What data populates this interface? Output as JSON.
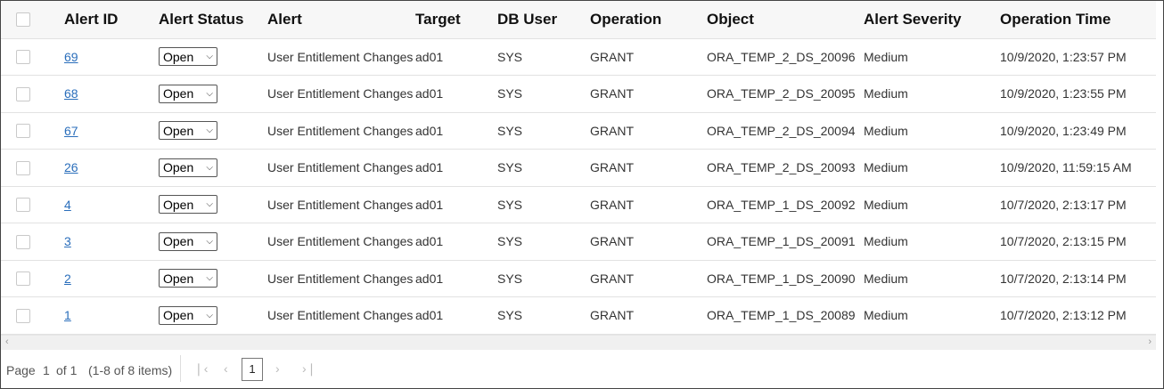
{
  "headers": {
    "alert_id": "Alert ID",
    "alert_status": "Alert Status",
    "alert": "Alert",
    "target": "Target",
    "db_user": "DB User",
    "operation": "Operation",
    "object": "Object",
    "alert_severity": "Alert Severity",
    "operation_time": "Operation Time"
  },
  "rows": [
    {
      "id": "69",
      "status": "Open",
      "alert": "User Entitlement Changes",
      "target": "ad01",
      "db_user": "SYS",
      "operation": "GRANT",
      "object": "ORA_TEMP_2_DS_20096",
      "severity": "Medium",
      "time": "10/9/2020, 1:23:57 PM"
    },
    {
      "id": "68",
      "status": "Open",
      "alert": "User Entitlement Changes",
      "target": "ad01",
      "db_user": "SYS",
      "operation": "GRANT",
      "object": "ORA_TEMP_2_DS_20095",
      "severity": "Medium",
      "time": "10/9/2020, 1:23:55 PM"
    },
    {
      "id": "67",
      "status": "Open",
      "alert": "User Entitlement Changes",
      "target": "ad01",
      "db_user": "SYS",
      "operation": "GRANT",
      "object": "ORA_TEMP_2_DS_20094",
      "severity": "Medium",
      "time": "10/9/2020, 1:23:49 PM"
    },
    {
      "id": "26",
      "status": "Open",
      "alert": "User Entitlement Changes",
      "target": "ad01",
      "db_user": "SYS",
      "operation": "GRANT",
      "object": "ORA_TEMP_2_DS_20093",
      "severity": "Medium",
      "time": "10/9/2020, 11:59:15 AM"
    },
    {
      "id": "4",
      "status": "Open",
      "alert": "User Entitlement Changes",
      "target": "ad01",
      "db_user": "SYS",
      "operation": "GRANT",
      "object": "ORA_TEMP_1_DS_20092",
      "severity": "Medium",
      "time": "10/7/2020, 2:13:17 PM"
    },
    {
      "id": "3",
      "status": "Open",
      "alert": "User Entitlement Changes",
      "target": "ad01",
      "db_user": "SYS",
      "operation": "GRANT",
      "object": "ORA_TEMP_1_DS_20091",
      "severity": "Medium",
      "time": "10/7/2020, 2:13:15 PM"
    },
    {
      "id": "2",
      "status": "Open",
      "alert": "User Entitlement Changes",
      "target": "ad01",
      "db_user": "SYS",
      "operation": "GRANT",
      "object": "ORA_TEMP_1_DS_20090",
      "severity": "Medium",
      "time": "10/7/2020, 2:13:14 PM"
    },
    {
      "id": "1",
      "status": "Open",
      "alert": "User Entitlement Changes",
      "target": "ad01",
      "db_user": "SYS",
      "operation": "GRANT",
      "object": "ORA_TEMP_1_DS_20089",
      "severity": "Medium",
      "time": "10/7/2020, 2:13:12 PM"
    }
  ],
  "pagination": {
    "page_label": "Page",
    "current_page": "1",
    "of_label": "of 1",
    "range_label": "(1-8 of 8 items)",
    "first_icon": "first-page-icon",
    "prev_icon": "prev-page-icon",
    "next_icon": "next-page-icon",
    "last_icon": "last-page-icon"
  },
  "colors": {
    "link": "#2a6ebb",
    "header_bg": "#f7f7f7",
    "border": "#e2e2e2"
  }
}
